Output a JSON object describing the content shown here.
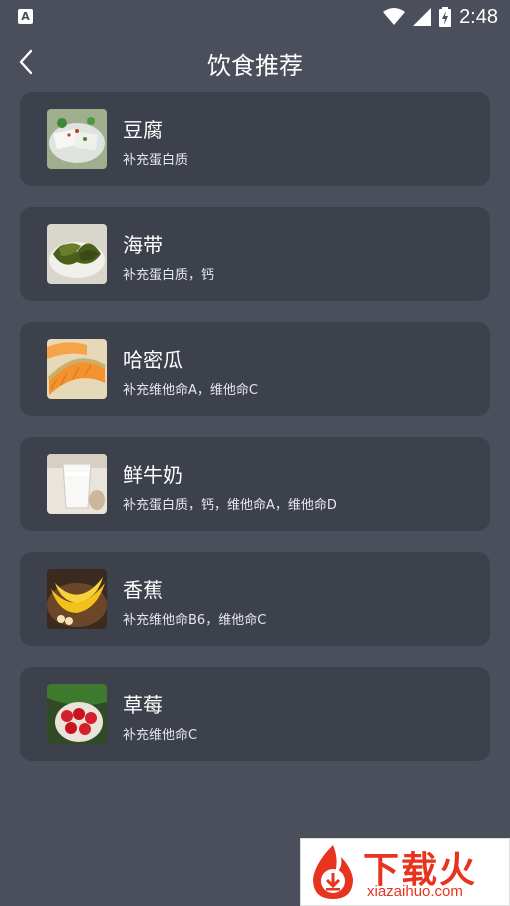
{
  "status_bar": {
    "time": "2:48",
    "app_icon_letter": "A"
  },
  "header": {
    "title": "饮食推荐"
  },
  "foods": [
    {
      "name": "豆腐",
      "desc": "补充蛋白质",
      "thumb": "tofu-photo"
    },
    {
      "name": "海带",
      "desc": "补充蛋白质，钙",
      "thumb": "kelp-photo"
    },
    {
      "name": "哈密瓜",
      "desc": "补充维他命A，维他命C",
      "thumb": "cantaloupe-photo"
    },
    {
      "name": "鲜牛奶",
      "desc": "补充蛋白质，钙，维他命A，维他命D",
      "thumb": "milk-photo"
    },
    {
      "name": "香蕉",
      "desc": "补充维他命B6，维他命C",
      "thumb": "banana-photo"
    },
    {
      "name": "草莓",
      "desc": "补充维他命C",
      "thumb": "strawberry-photo"
    }
  ],
  "watermark": {
    "brand": "下载火",
    "url": "xiazaihuo.com"
  },
  "colors": {
    "background": "#4a4f5b",
    "card": "#3d414b",
    "watermark_red": "#e8331e"
  }
}
